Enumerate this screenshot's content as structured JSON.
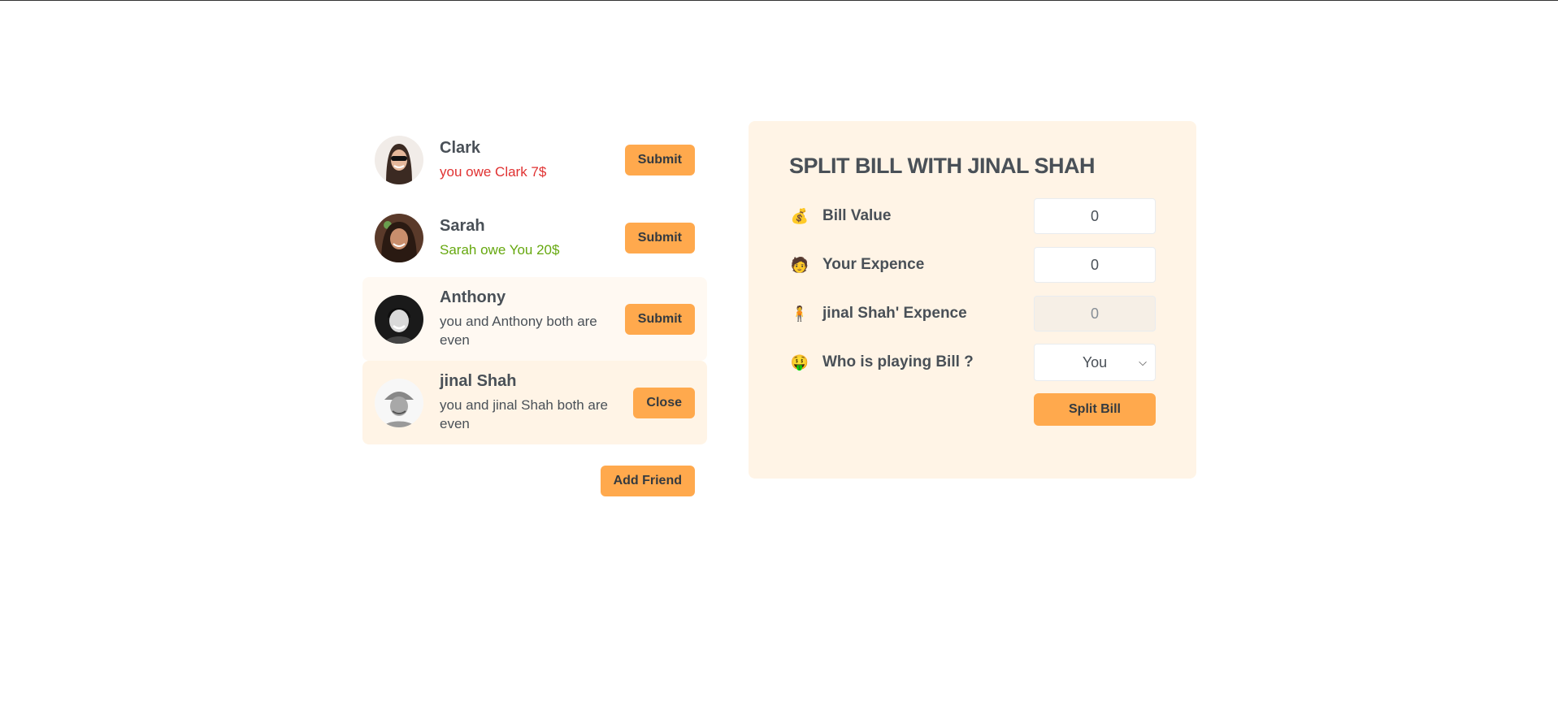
{
  "friends": [
    {
      "name": "Clark",
      "status": "you owe Clark 7$",
      "button": "Submit"
    },
    {
      "name": "Sarah",
      "status": "Sarah owe You 20$",
      "button": "Submit"
    },
    {
      "name": "Anthony",
      "status": "you and Anthony both are even",
      "button": "Submit"
    },
    {
      "name": "jinal Shah",
      "status": "you and jinal Shah both are even",
      "button": "Close"
    }
  ],
  "add_friend_label": "Add Friend",
  "split_form": {
    "title": "Split bill with jinal Shah",
    "bill_label": "Bill Value",
    "bill_value": "0",
    "your_label": "Your Expence",
    "your_value": "0",
    "friend_label": "jinal Shah' Expence",
    "friend_value": "0",
    "payer_label": "Who is playing Bill ?",
    "payer_value": "You",
    "submit_label": "Split Bill",
    "icons": [
      "money-bag-icon",
      "person-icon",
      "standing-person-icon",
      "money-face-icon"
    ]
  },
  "colors": {
    "accent": "#ffa94d",
    "panel": "#fff4e6",
    "red": "#e03131",
    "green": "#66a80f"
  }
}
